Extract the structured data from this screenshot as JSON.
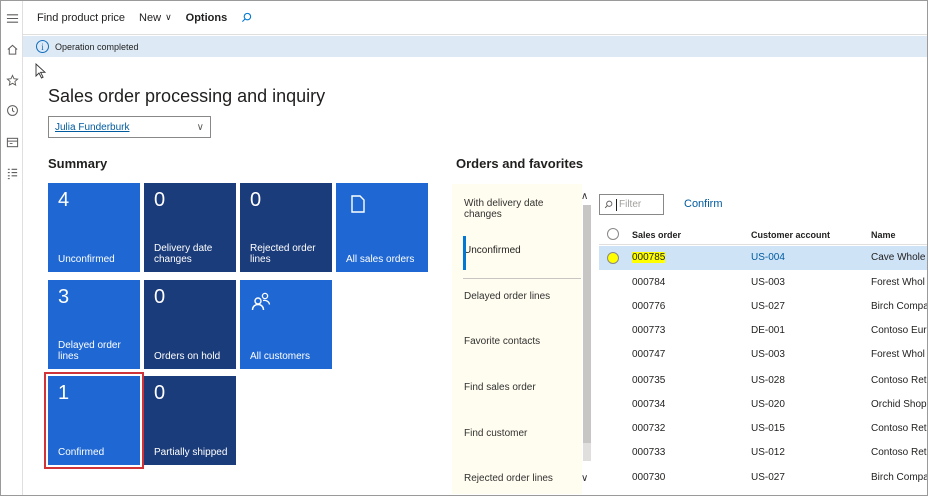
{
  "actionbar": {
    "find_price": "Find product price",
    "new": "New",
    "options": "Options"
  },
  "infobar": {
    "message": "Operation completed"
  },
  "page": {
    "title": "Sales order processing and inquiry",
    "user": "Julia Funderburk"
  },
  "summary": {
    "heading": "Summary",
    "tiles": [
      {
        "count": "4",
        "label": "Unconfirmed"
      },
      {
        "count": "0",
        "label": "Delivery date changes"
      },
      {
        "count": "0",
        "label": "Rejected order lines"
      },
      {
        "label": "All sales orders",
        "icon": "document-icon"
      },
      {
        "count": "3",
        "label": "Delayed order lines"
      },
      {
        "count": "0",
        "label": "Orders on hold"
      },
      {
        "label": "All customers",
        "icon": "people-icon"
      },
      {
        "count": "1",
        "label": "Confirmed"
      },
      {
        "count": "0",
        "label": "Partially shipped"
      }
    ]
  },
  "orders": {
    "heading": "Orders and favorites",
    "tabs": [
      "With delivery date changes",
      "Unconfirmed",
      "Delayed order lines",
      "Favorite contacts",
      "Find sales order",
      "Find customer",
      "Rejected order lines"
    ],
    "filter_placeholder": "Filter",
    "confirm": "Confirm",
    "columns": [
      "Sales order",
      "Customer account",
      "Name"
    ],
    "rows": [
      {
        "order": "000785",
        "account": "US-004",
        "name": "Cave Whole"
      },
      {
        "order": "000784",
        "account": "US-003",
        "name": "Forest Whol"
      },
      {
        "order": "000776",
        "account": "US-027",
        "name": "Birch Compa"
      },
      {
        "order": "000773",
        "account": "DE-001",
        "name": "Contoso Eur"
      },
      {
        "order": "000747",
        "account": "US-003",
        "name": "Forest Whol"
      },
      {
        "order": "000735",
        "account": "US-028",
        "name": "Contoso Ret"
      },
      {
        "order": "000734",
        "account": "US-020",
        "name": "Orchid Shop"
      },
      {
        "order": "000732",
        "account": "US-015",
        "name": "Contoso Ret"
      },
      {
        "order": "000733",
        "account": "US-012",
        "name": "Contoso Ret"
      },
      {
        "order": "000730",
        "account": "US-027",
        "name": "Birch Compa"
      }
    ]
  },
  "colors": {
    "tile_dark": "#1b3c7a",
    "tile_blue": "#1f68d3",
    "selection_outline": "#d13438",
    "info_bar": "#ddeaf6",
    "link": "#005a9e",
    "highlight": "#ffff00"
  }
}
